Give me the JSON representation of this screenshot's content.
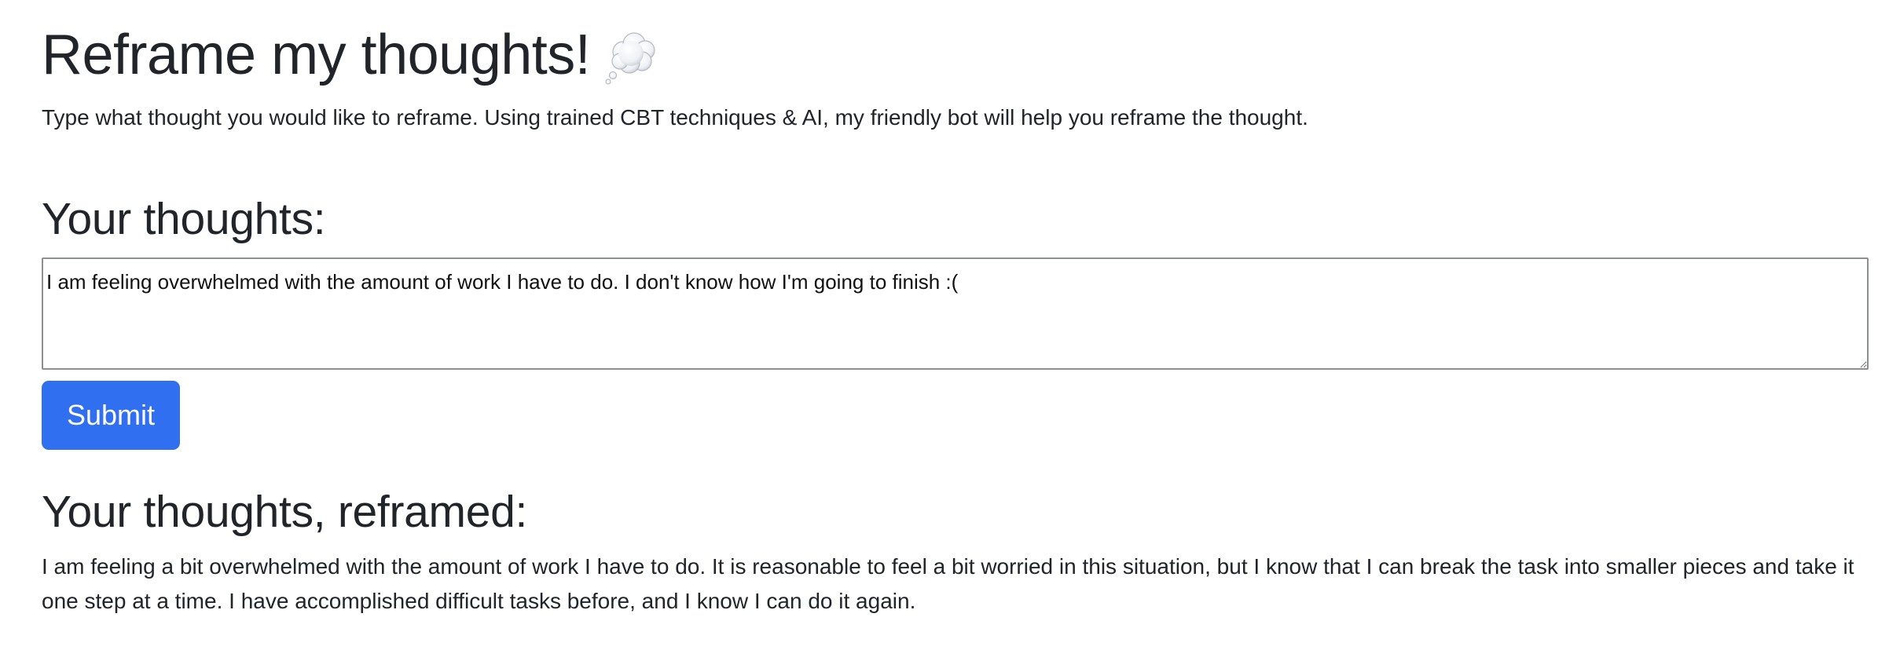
{
  "header": {
    "title": "Reframe my thoughts!",
    "title_icon": "thought-bubble-icon",
    "description": "Type what thought you would like to reframe. Using trained CBT techniques & AI, my friendly bot will help you reframe the thought."
  },
  "input_section": {
    "heading": "Your thoughts:",
    "value": "I am feeling overwhelmed with the amount of work I have to do. I don't know how I'm going to finish :(",
    "submit_label": "Submit"
  },
  "output_section": {
    "heading": "Your thoughts, reframed:",
    "text": "I am feeling a bit overwhelmed with the amount of work I have to do. It is reasonable to feel a bit worried in this situation, but I know that I can break the task into smaller pieces and take it one step at a time. I have accomplished difficult tasks before, and I know I can do it again."
  },
  "colors": {
    "accent": "#2f6ff0",
    "text": "#212529",
    "border": "#8c8f94"
  }
}
